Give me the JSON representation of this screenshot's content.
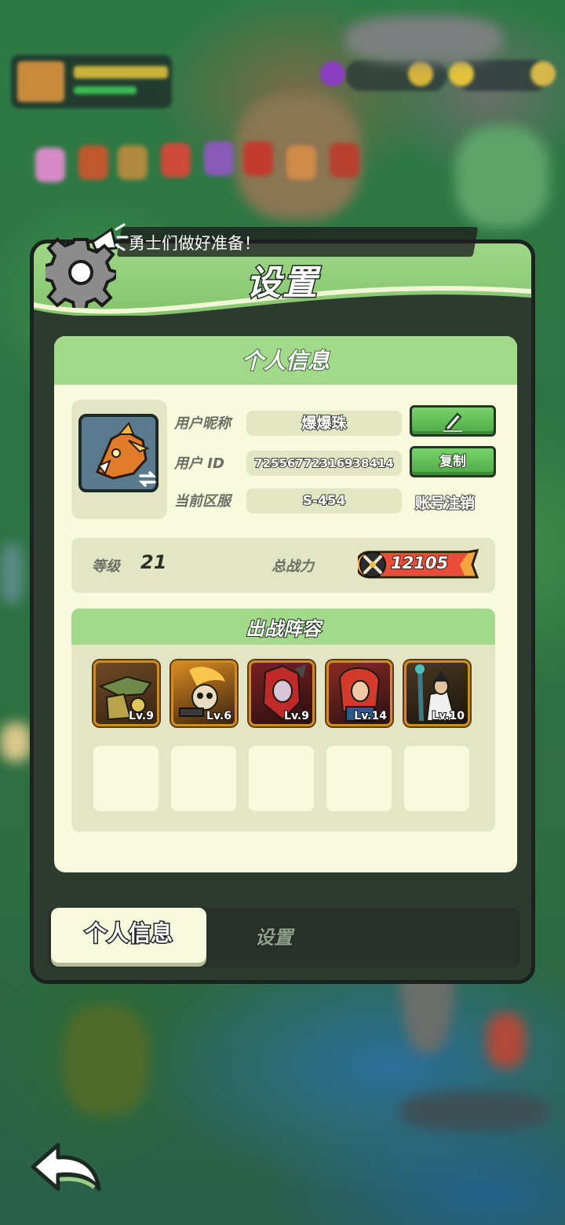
{
  "notice": {
    "text": "勇士们做好准备！"
  },
  "panel": {
    "title": "设置"
  },
  "profile_card": {
    "header": "个人信息",
    "labels": {
      "nickname": "用户昵称",
      "user_id": "用户  ID",
      "server": "当前区服"
    },
    "nickname": "爆爆珠",
    "user_id": "72556772316938414",
    "server": "S-454",
    "copy_button": "复制",
    "logout_link": "账号注销"
  },
  "stats": {
    "level_label": "等级",
    "level": "21",
    "power_label": "总战力",
    "power": "12105"
  },
  "lineup": {
    "header": "出战阵容",
    "heroes": [
      {
        "level": "Lv.9",
        "color": "#8a5a2a"
      },
      {
        "level": "Lv.6",
        "color": "#c67a1e"
      },
      {
        "level": "Lv.9",
        "color": "#9b2a2a"
      },
      {
        "level": "Lv.14",
        "color": "#b5352c"
      },
      {
        "level": "Lv.10",
        "color": "#3c2c1e"
      }
    ],
    "empty_slots": 5
  },
  "tabs": {
    "active": "个人信息",
    "inactive": "设置"
  },
  "colors": {
    "header_green": "#9fd789",
    "card_bg": "#f7fadd",
    "button_green": "#5cbf4f",
    "hero_border": "#d08a1e"
  }
}
